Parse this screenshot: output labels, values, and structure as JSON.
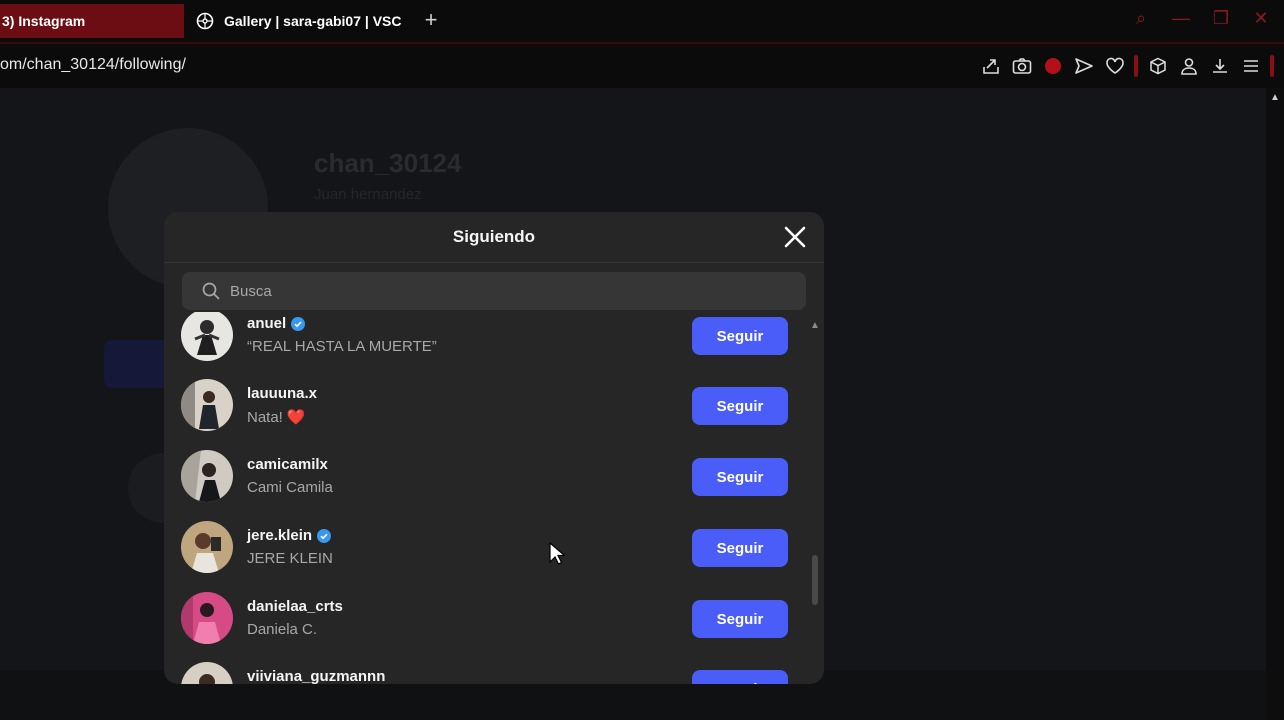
{
  "browser": {
    "tabs": [
      {
        "title": "3) Instagram",
        "active": true
      },
      {
        "title": "Gallery | sara-gabi07 | VSC",
        "active": false
      }
    ],
    "new_tab": "+",
    "url": "om/chan_30124/following/",
    "toolbar_icons": [
      "share-icon",
      "camera-icon",
      "record-icon",
      "send-icon",
      "heart-icon",
      "cube-icon",
      "user-icon",
      "download-icon",
      "menu-icon"
    ]
  },
  "profile_bg": {
    "username": "chan_30124",
    "fullname": "Juan hernandez"
  },
  "modal": {
    "title": "Siguiendo",
    "search_placeholder": "Busca",
    "follow_label": "Seguir",
    "accent": "#4a5df9",
    "items": [
      {
        "username": "anuel",
        "verified": true,
        "fullname": "“REAL HASTA LA MUERTE”",
        "emoji": ""
      },
      {
        "username": "lauuuna.x",
        "verified": false,
        "fullname": "Nata!",
        "emoji": "❤️"
      },
      {
        "username": "camicamilx",
        "verified": false,
        "fullname": "Cami Camila",
        "emoji": ""
      },
      {
        "username": "jere.klein",
        "verified": true,
        "fullname": "JERE KLEIN",
        "emoji": ""
      },
      {
        "username": "danielaa_crts",
        "verified": false,
        "fullname": "Daniela C.",
        "emoji": ""
      },
      {
        "username": "viiviana_guzmannn",
        "verified": false,
        "fullname": "",
        "emoji": ""
      }
    ]
  }
}
